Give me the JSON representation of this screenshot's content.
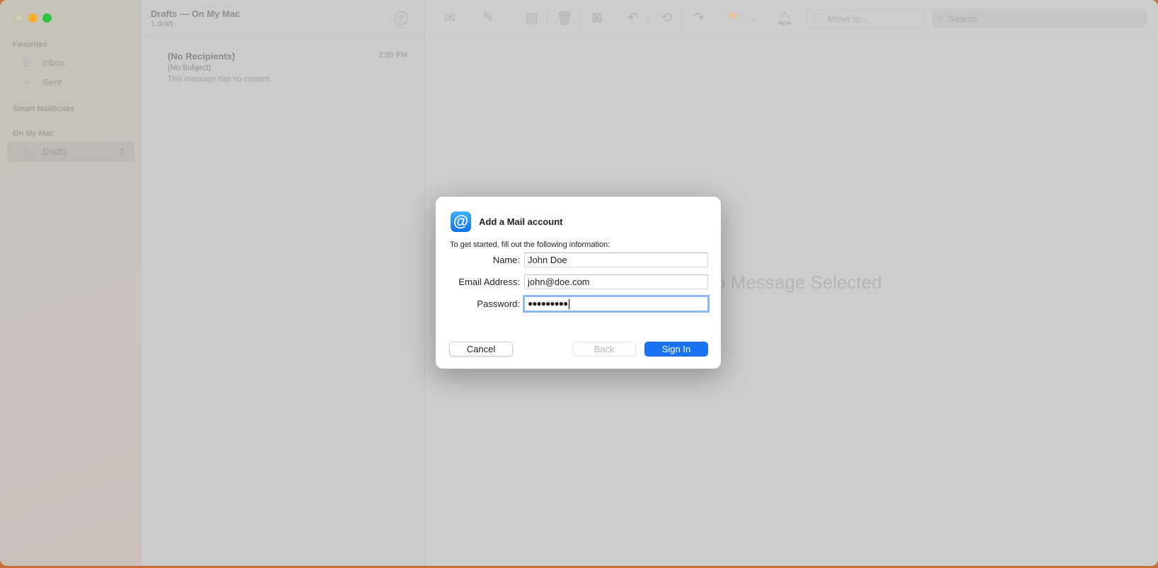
{
  "sidebar": {
    "favorites": "Favorites",
    "inbox": "Inbox",
    "sent": "Sent",
    "smart": "Smart Mailboxes",
    "onmymac": "On My Mac",
    "drafts": "Drafts",
    "drafts_count": "1"
  },
  "list": {
    "title": "Drafts — On My Mac",
    "subtitle": "1 draft",
    "messages": [
      {
        "from": "(No Recipients)",
        "time": "2:55 PM",
        "subject": "(No Subject)",
        "preview": "This message has no content."
      }
    ]
  },
  "toolbar": {
    "move_to": "Move to...",
    "search_placeholder": "Search",
    "icons": [
      "envelope-icon",
      "compose-icon",
      "archive-icon",
      "trash-icon",
      "junk-icon",
      "reply-icon",
      "reply-all-icon",
      "forward-icon",
      "flag-icon",
      "chevron-down-icon",
      "bell-icon"
    ]
  },
  "content": {
    "empty": "No Message Selected"
  },
  "dialog": {
    "title": "Add a Mail account",
    "subtitle": "To get started, fill out the following information:",
    "name_label": "Name:",
    "name_value": "John Doe",
    "email_label": "Email Address:",
    "email_value": "john@doe.com",
    "password_label": "Password:",
    "password_value": "●●●●●●●●●",
    "cancel": "Cancel",
    "back": "Back",
    "signin": "Sign In"
  },
  "colors": {
    "accent": "#1a73f5",
    "flag": "#e8c49a"
  }
}
